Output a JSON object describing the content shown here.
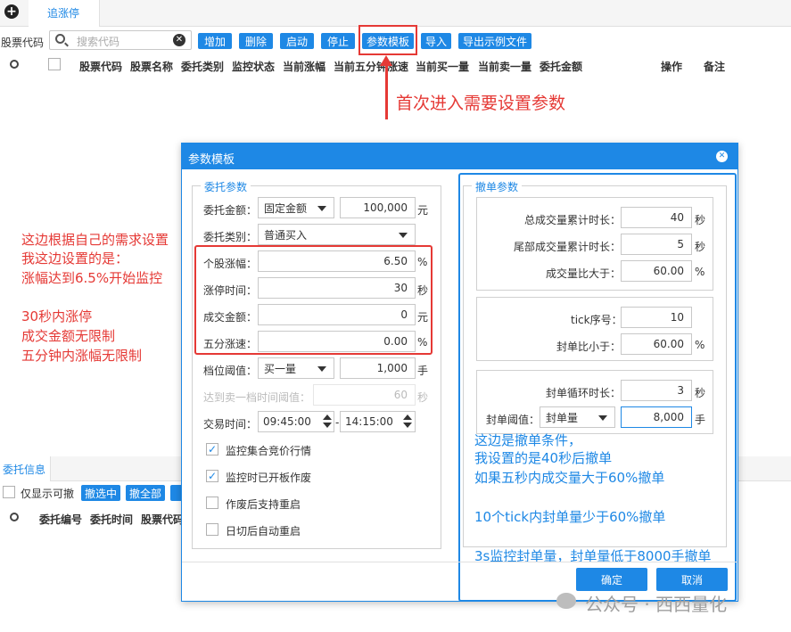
{
  "topbar": {
    "tab_label": "追涨停"
  },
  "toolbar": {
    "code_label": "股票代码",
    "search_placeholder": "搜索代码",
    "buttons": [
      "增加",
      "删除",
      "启动",
      "停止",
      "参数模板",
      "导入",
      "导出示例文件"
    ]
  },
  "table": {
    "columns": [
      "股票代码",
      "股票名称",
      "委托类别",
      "监控状态",
      "当前涨幅",
      "当前五分钟涨速",
      "当前买一量",
      "当前卖一量",
      "委托金额",
      "操作",
      "备注"
    ]
  },
  "callout_top": "首次进入需要设置参数",
  "left_notes": [
    "这边根据自己的需求设置",
    "我这边设置的是：",
    "涨幅达到6.5%开始监控",
    "",
    "30秒内涨停",
    "成交金额无限制",
    "五分钟内涨幅无限制"
  ],
  "bottom": {
    "tab_label": "委托信息",
    "checkbox_label": "仅显示可撤",
    "buttons": [
      "撤选中",
      "撤全部"
    ],
    "columns": [
      "委托编号",
      "委托时间",
      "股票代码"
    ]
  },
  "dialog": {
    "title": "参数模板",
    "left_group_title": "委托参数",
    "amount": {
      "label": "委托金额：",
      "mode": "固定金额",
      "value": "100,000",
      "unit": "元"
    },
    "category": {
      "label": "委托类别：",
      "value": "普通买入"
    },
    "rise": {
      "label": "个股涨幅：",
      "value": "6.50",
      "unit": "%"
    },
    "limit_time": {
      "label": "涨停时间：",
      "value": "30",
      "unit": "秒"
    },
    "deal_amount": {
      "label": "成交金额：",
      "value": "0",
      "unit": "元"
    },
    "five_speed": {
      "label": "五分涨速：",
      "value": "0.00",
      "unit": "%"
    },
    "level": {
      "label": "档位阈值：",
      "mode": "买一量",
      "value": "1,000",
      "unit": "手"
    },
    "reach_sell": {
      "label": "达到卖一档时间阈值：",
      "value": "60",
      "unit": "秒"
    },
    "trade_time": {
      "label": "交易时间：",
      "start": "09:45:00",
      "sep": "-",
      "end": "14:15:00"
    },
    "checks": [
      {
        "label": "监控集合竞价行情",
        "checked": true
      },
      {
        "label": "监控时已开板作废",
        "checked": true
      },
      {
        "label": "作废后支持重启",
        "checked": false
      },
      {
        "label": "日切后自动重启",
        "checked": false
      }
    ],
    "right_group_title": "撤单参数",
    "total_vol_time": {
      "label": "总成交量累计时长：",
      "value": "40",
      "unit": "秒"
    },
    "tail_vol_time": {
      "label": "尾部成交量累计时长：",
      "value": "5",
      "unit": "秒"
    },
    "vol_ratio": {
      "label": "成交量比大于：",
      "value": "60.00",
      "unit": "%"
    },
    "tick": {
      "label": "tick序号：",
      "value": "10"
    },
    "seal_ratio": {
      "label": "封单比小于：",
      "value": "60.00",
      "unit": "%"
    },
    "seal_cycle": {
      "label": "封单循环时长：",
      "value": "3",
      "unit": "秒"
    },
    "seal_threshold": {
      "label": "封单阈值：",
      "mode": "封单量",
      "value": "8,000",
      "unit": "手"
    },
    "ok": "确定",
    "cancel": "取消"
  },
  "right_notes": [
    "这边是撤单条件，",
    "我设置的是40秒后撤单",
    "如果五秒内成交量大于60%撤单",
    "",
    "10个tick内封单量少于60%撤单",
    "",
    "3s监控封单量，封单量低于8000手撤单"
  ],
  "watermark": "公众号 · 西西量化",
  "colors": {
    "accent": "#1e88e5",
    "annotation_red": "#e53935"
  }
}
